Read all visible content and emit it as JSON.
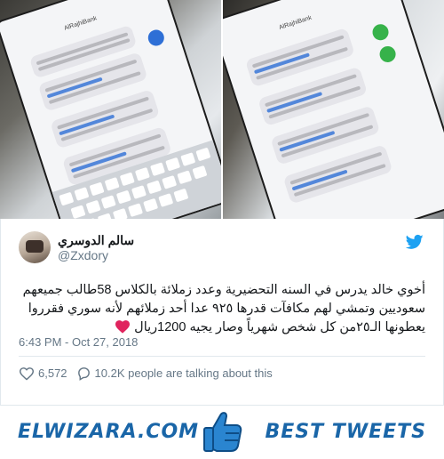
{
  "tweet": {
    "display_name": "سالم الدوسري",
    "handle": "@Zxdory",
    "text": "أخوي خالد يدرس في السنه التحضيرية وعدد زملائة بالكلاس 58طالب جميعهم سعوديين وتمشي لهم مكافآت قدرها ٩٢٥ عدا أحد زملائهم لأنه سوري فقرروا يعطونها الـ٢٥من كل شخص شهرياً وصار يجيه 1200ريال",
    "timestamp": "6:43 PM - Oct 27, 2018",
    "likes": "6,572",
    "talking": "10.2K people are talking about this",
    "heart_color": "#e0245e",
    "twitter_color": "#1da1f2"
  },
  "photos": {
    "left": {
      "sender": "AlRajhiBank"
    },
    "right": {
      "sender": "AlRajhiBank"
    }
  },
  "banner": {
    "site": "ELWIZARA.COM",
    "tagline": "BEST TWEETS",
    "brand_color": "#1a66a8",
    "icon": "thumbs-up-icon"
  }
}
